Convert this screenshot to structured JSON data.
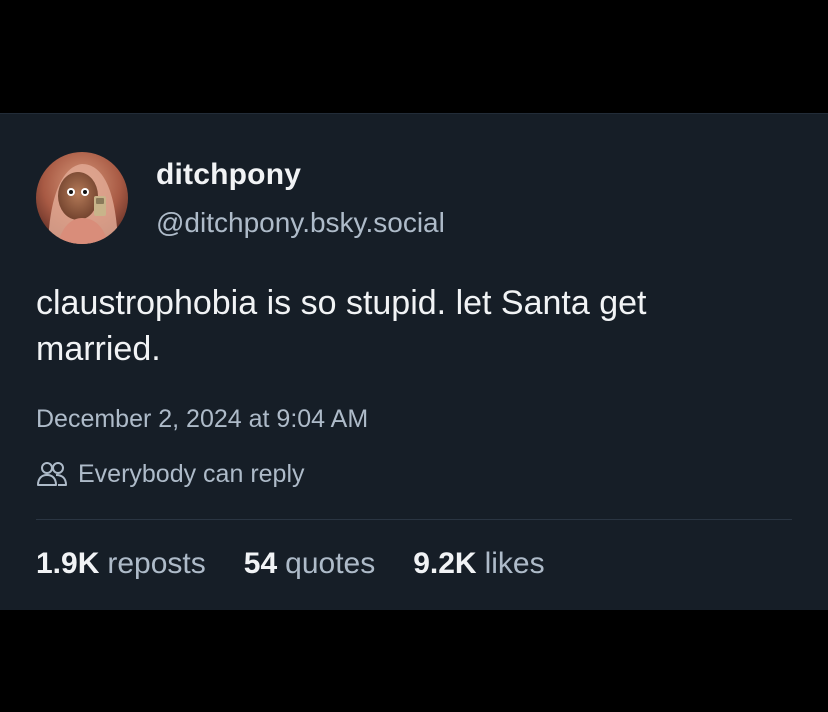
{
  "post": {
    "author": {
      "display_name": "ditchpony",
      "handle": "@ditchpony.bsky.social",
      "avatar_icon": "profile-photo-avatar"
    },
    "text": "claustrophobia is so stupid. let Santa get married.",
    "timestamp": "December 2, 2024 at 9:04 AM",
    "reply_setting": {
      "icon": "people-icon",
      "label": "Everybody can reply"
    },
    "stats": {
      "reposts": {
        "count": "1.9K",
        "label": "reposts"
      },
      "quotes": {
        "count": "54",
        "label": "quotes"
      },
      "likes": {
        "count": "9.2K",
        "label": "likes"
      }
    }
  },
  "theme": {
    "background": "#000000",
    "card": "#161e27",
    "text_primary": "#f1f3f5",
    "text_secondary": "#aebbc9",
    "divider": "#2a3542"
  }
}
